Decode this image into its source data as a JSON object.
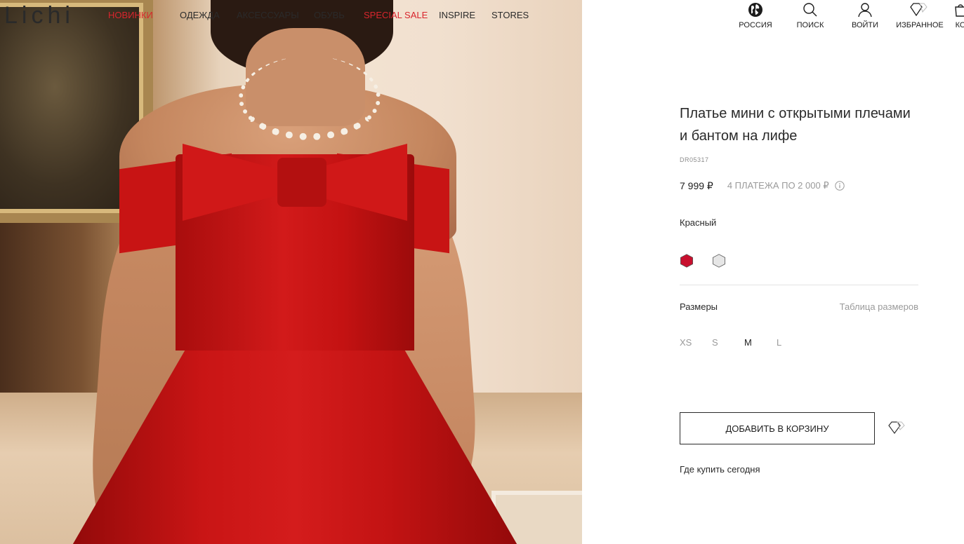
{
  "brand": {
    "logo_text": "Lichi"
  },
  "nav": {
    "items": [
      {
        "label": "НОВИНКИ",
        "highlight": true
      },
      {
        "label": "ОДЕЖДА",
        "highlight": false
      },
      {
        "label": "АКСЕССУАРЫ",
        "highlight": false
      },
      {
        "label": "ОБУВЬ",
        "highlight": false
      },
      {
        "label": "SPECIAL SALE",
        "highlight": true
      },
      {
        "label": "INSPIRE",
        "highlight": false
      },
      {
        "label": "STORES",
        "highlight": false
      }
    ]
  },
  "header_icons": [
    {
      "icon": "globe-icon",
      "label": "РОССИЯ"
    },
    {
      "icon": "search-icon",
      "label": "ПОИСК"
    },
    {
      "icon": "user-icon",
      "label": "ВОЙТИ"
    },
    {
      "icon": "diamond-heart-icon",
      "label": "ИЗБРАННОЕ"
    },
    {
      "icon": "cart-icon",
      "label": "КО"
    }
  ],
  "product": {
    "title": "Платье мини с открытыми плечами и бантом на лифе",
    "sku": "DR05317",
    "price": "7 999 ₽",
    "installments": "4 ПЛАТЕЖА ПО 2 000 ₽",
    "color_name": "Красный",
    "colors": [
      "#c8102e",
      "#e6e6e6"
    ],
    "sizes_label": "Размеры",
    "size_chart_link": "Таблица размеров",
    "sizes": [
      "XS",
      "S",
      "M",
      "L"
    ],
    "selected_size": "M",
    "add_to_cart": "ДОБАВИТЬ В КОРЗИНУ",
    "where_to_buy": "Где купить сегодня"
  },
  "colors": {
    "accent": "#d9252d",
    "text": "#2a2a2a",
    "muted": "#9a9a9a"
  }
}
